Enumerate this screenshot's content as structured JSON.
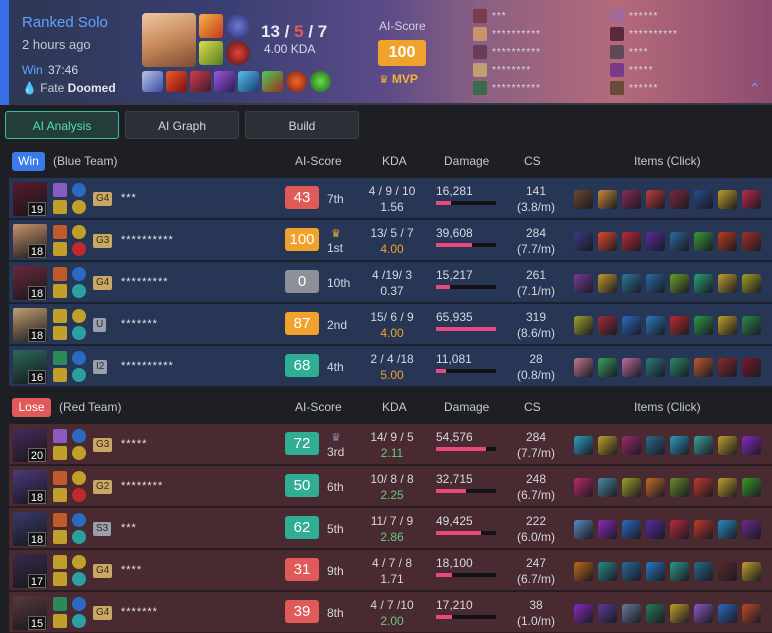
{
  "header": {
    "mode": "Ranked Solo",
    "ago": "2 hours ago",
    "result": "Win",
    "duration": "37:46",
    "fate_label": "Fate",
    "fate_value": "Doomed",
    "kills": "13",
    "deaths": "5",
    "assists": "7",
    "sep1": "/",
    "sep2": "/",
    "kda_ratio": "4.00 KDA",
    "ai_label": "AI-Score",
    "ai_value": "100",
    "mvp": "MVP",
    "roster_left": [
      "***",
      "**********",
      "**********",
      "********",
      "**********"
    ],
    "roster_right": [
      "******",
      "**********",
      "****",
      "*****",
      "******"
    ]
  },
  "tabs": [
    {
      "label": "AI Analysis",
      "active": true
    },
    {
      "label": "AI Graph"
    },
    {
      "label": "Build"
    }
  ],
  "columns": {
    "ai": "AI-Score",
    "kda": "KDA",
    "damage": "Damage",
    "cs": "CS",
    "items": "Items (Click)"
  },
  "teams": [
    {
      "result": "Win",
      "label": "(Blue Team)",
      "color": "#3a7bea",
      "rows_bg": "#283656",
      "players": [
        {
          "level": "19",
          "tier": "G4",
          "name": "***",
          "score": "43",
          "score_color": "#e05a5a",
          "rank": "7th",
          "kda": "4 / 9 / 10",
          "kda_ratio": "1.56",
          "ratio_style": "",
          "damage": "16,281",
          "damage_frac": 0.25,
          "cs": "141",
          "cs_rate": "(3.8/m)"
        },
        {
          "level": "18",
          "tier": "G3",
          "name": "**********",
          "score": "100",
          "score_color": "#f0a22c",
          "rank": "1st",
          "crown": "gold",
          "kda": "13/ 5 / 7",
          "kda_ratio": "4.00",
          "ratio_style": "hi",
          "damage": "39,608",
          "damage_frac": 0.6,
          "cs": "284",
          "cs_rate": "(7.7/m)"
        },
        {
          "level": "18",
          "tier": "G4",
          "name": "*********",
          "score": "0",
          "score_color": "#8c9099",
          "rank": "10th",
          "kda": "4 /19/ 3",
          "kda_ratio": "0.37",
          "ratio_style": "",
          "damage": "15,217",
          "damage_frac": 0.23,
          "cs": "261",
          "cs_rate": "(7.1/m)"
        },
        {
          "level": "18",
          "tier": "U",
          "name": "*******",
          "score": "87",
          "score_color": "#f0a22c",
          "rank": "2nd",
          "kda": "15/ 6 / 9",
          "kda_ratio": "4.00",
          "ratio_style": "hi",
          "damage": "65,935",
          "damage_frac": 1.0,
          "cs": "319",
          "cs_rate": "(8.6/m)"
        },
        {
          "level": "16",
          "tier": "I2",
          "name": "**********",
          "score": "68",
          "score_color": "#2fae93",
          "rank": "4th",
          "kda": "2 / 4 /18",
          "kda_ratio": "5.00",
          "ratio_style": "hi",
          "damage": "11,081",
          "damage_frac": 0.17,
          "cs": "28",
          "cs_rate": "(0.8/m)"
        }
      ]
    },
    {
      "result": "Lose",
      "label": "(Red Team)",
      "color": "#e05a5a",
      "rows_bg": "#4a2a31",
      "players": [
        {
          "level": "20",
          "tier": "G3",
          "name": "*****",
          "score": "72",
          "score_color": "#2fae93",
          "rank": "3rd",
          "crown": "silver",
          "kda": "14/ 9 / 5",
          "kda_ratio": "2.11",
          "ratio_style": "gr",
          "damage": "54,576",
          "damage_frac": 0.83,
          "cs": "284",
          "cs_rate": "(7.7/m)"
        },
        {
          "level": "18",
          "tier": "G2",
          "name": "********",
          "score": "50",
          "score_color": "#2fae93",
          "rank": "6th",
          "kda": "10/ 8 / 8",
          "kda_ratio": "2.25",
          "ratio_style": "gr",
          "damage": "32,715",
          "damage_frac": 0.5,
          "cs": "248",
          "cs_rate": "(6.7/m)"
        },
        {
          "level": "18",
          "tier": "S3",
          "name": "***",
          "score": "62",
          "score_color": "#2fae93",
          "rank": "5th",
          "kda": "11/ 7 / 9",
          "kda_ratio": "2.86",
          "ratio_style": "gr",
          "damage": "49,425",
          "damage_frac": 0.75,
          "cs": "222",
          "cs_rate": "(6.0/m)"
        },
        {
          "level": "17",
          "tier": "G4",
          "name": "****",
          "score": "31",
          "score_color": "#e05a5a",
          "rank": "9th",
          "kda": "4 / 7 / 8",
          "kda_ratio": "1.71",
          "ratio_style": "",
          "damage": "18,100",
          "damage_frac": 0.27,
          "cs": "247",
          "cs_rate": "(6.7/m)"
        },
        {
          "level": "15",
          "tier": "G4",
          "name": "*******",
          "score": "39",
          "score_color": "#e05a5a",
          "rank": "8th",
          "kda": "4 / 7 /10",
          "kda_ratio": "2.00",
          "ratio_style": "gr",
          "damage": "17,210",
          "damage_frac": 0.26,
          "cs": "38",
          "cs_rate": "(1.0/m)"
        }
      ]
    }
  ]
}
